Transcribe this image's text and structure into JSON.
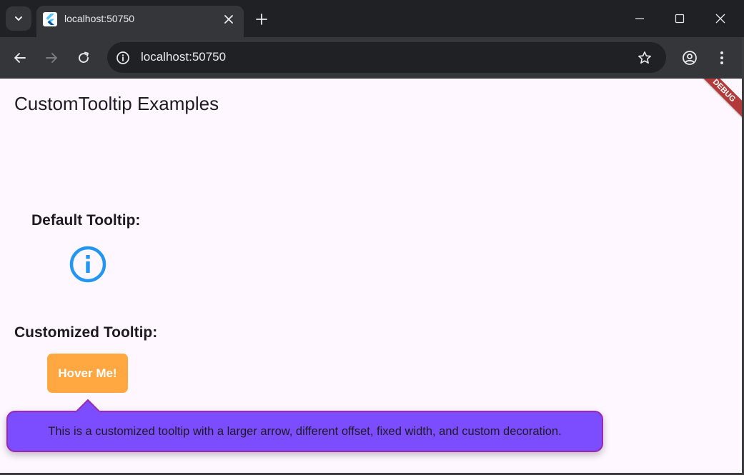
{
  "browser": {
    "tab_title": "localhost:50750",
    "url": "localhost:50750",
    "icons": [
      "tab-search-icon",
      "flutter-favicon-icon",
      "close-icon",
      "plus-icon",
      "minimize-icon",
      "maximize-icon",
      "close-window-icon",
      "back-icon",
      "forward-icon",
      "reload-icon",
      "site-info-icon",
      "star-icon",
      "profile-icon",
      "menu-icon"
    ]
  },
  "app": {
    "title": "CustomTooltip Examples",
    "debug_banner": "DEBUG",
    "default_label": "Default Tooltip:",
    "custom_label": "Customized Tooltip:",
    "hover_button": "Hover Me!",
    "tooltip_text": "This is a customized tooltip with a larger arrow, different offset, fixed width, and custom decoration."
  },
  "colors": {
    "page_bg": "#fef7ff",
    "info_icon": "#2196f3",
    "button": "#ffa842",
    "tooltip_bg": "#7c4dff",
    "tooltip_border": "#9c27b0",
    "debug_banner": "#b33a3a"
  }
}
